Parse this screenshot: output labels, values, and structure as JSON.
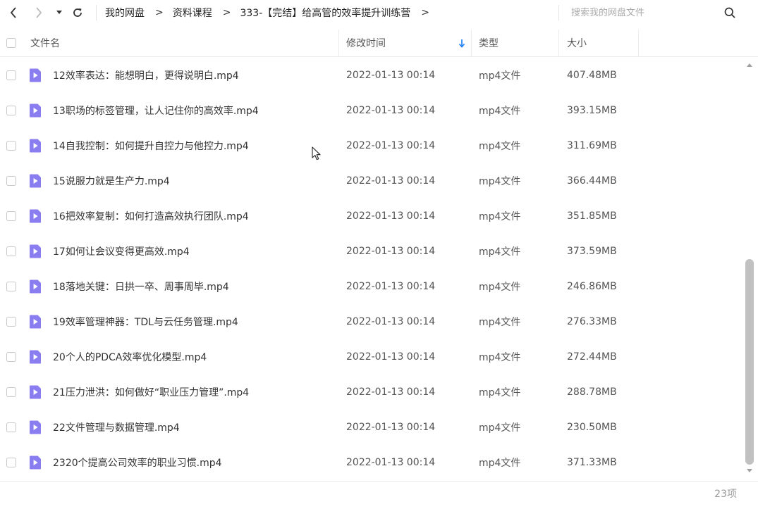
{
  "nav": {
    "back_icon": "chevron-left",
    "forward_icon": "chevron-right",
    "history_icon": "caret-down",
    "refresh_icon": "refresh"
  },
  "breadcrumb": {
    "items": [
      "我的网盘",
      "资料课程",
      "333-【完结】给高管的效率提升训练营"
    ],
    "separator": ">"
  },
  "search": {
    "placeholder": "搜索我的网盘文件",
    "value": "",
    "icon": "search"
  },
  "columns": {
    "name": "文件名",
    "modified": "修改时间",
    "type": "类型",
    "size": "大小",
    "sort_icon": "arrow-down",
    "sort_color": "#1a7cf5"
  },
  "files": [
    {
      "name": "12效率表达：能想明白，更得说明白.mp4",
      "modified": "2022-01-13 00:14",
      "type": "mp4文件",
      "size": "407.48MB"
    },
    {
      "name": "13职场的标签管理，让人记住你的高效率.mp4",
      "modified": "2022-01-13 00:14",
      "type": "mp4文件",
      "size": "393.15MB"
    },
    {
      "name": "14自我控制：如何提升自控力与他控力.mp4",
      "modified": "2022-01-13 00:14",
      "type": "mp4文件",
      "size": "311.69MB"
    },
    {
      "name": "15说服力就是生产力.mp4",
      "modified": "2022-01-13 00:14",
      "type": "mp4文件",
      "size": "366.44MB"
    },
    {
      "name": "16把效率复制：如何打造高效执行团队.mp4",
      "modified": "2022-01-13 00:14",
      "type": "mp4文件",
      "size": "351.85MB"
    },
    {
      "name": "17如何让会议变得更高效.mp4",
      "modified": "2022-01-13 00:14",
      "type": "mp4文件",
      "size": "373.59MB"
    },
    {
      "name": "18落地关键：日拱一卒、周事周毕.mp4",
      "modified": "2022-01-13 00:14",
      "type": "mp4文件",
      "size": "246.86MB"
    },
    {
      "name": "19效率管理神器：TDL与云任务管理.mp4",
      "modified": "2022-01-13 00:14",
      "type": "mp4文件",
      "size": "276.33MB"
    },
    {
      "name": "20个人的PDCA效率优化模型.mp4",
      "modified": "2022-01-13 00:14",
      "type": "mp4文件",
      "size": "272.44MB"
    },
    {
      "name": "21压力泄洪：如何做好“职业压力管理”.mp4",
      "modified": "2022-01-13 00:14",
      "type": "mp4文件",
      "size": "288.78MB"
    },
    {
      "name": "22文件管理与数据管理.mp4",
      "modified": "2022-01-13 00:14",
      "type": "mp4文件",
      "size": "230.50MB"
    },
    {
      "name": "2320个提高公司效率的职业习惯.mp4",
      "modified": "2022-01-13 00:14",
      "type": "mp4文件",
      "size": "371.33MB"
    }
  ],
  "file_icon": "video-file-icon",
  "file_icon_color": "#8a7df0",
  "footer": {
    "count": "23项"
  }
}
